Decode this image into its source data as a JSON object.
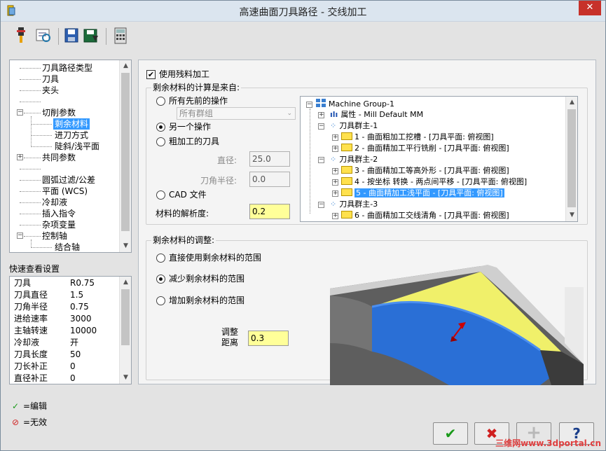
{
  "window": {
    "title": "高速曲面刀具路径 - 交线加工",
    "close_glyph": "✕"
  },
  "toolbar": {
    "icons": [
      "tool-icon",
      "preview-icon",
      "save-icon",
      "load-icon",
      "calculator-icon"
    ]
  },
  "nav_tree": {
    "items": [
      {
        "label": "刀具路径类型"
      },
      {
        "label": "刀具"
      },
      {
        "label": "夹头"
      },
      {
        "label": ""
      },
      {
        "label": "切削参数"
      },
      {
        "label": "剩余材料"
      },
      {
        "label": "进刀方式"
      },
      {
        "label": "陡斜/浅平面"
      },
      {
        "label": "共同参数"
      },
      {
        "label": ""
      },
      {
        "label": "圆弧过滤/公差"
      },
      {
        "label": "平面 (WCS)"
      },
      {
        "label": "冷却液"
      },
      {
        "label": "插入指令"
      },
      {
        "label": "杂项变量"
      },
      {
        "label": "控制轴"
      },
      {
        "label": "结合轴"
      }
    ]
  },
  "quick_view": {
    "title": "快速查看设置",
    "rows": [
      {
        "key": "刀具",
        "value": "R0.75"
      },
      {
        "key": "刀具直径",
        "value": "1.5"
      },
      {
        "key": "刀角半径",
        "value": "0.75"
      },
      {
        "key": "进给速率",
        "value": "3000"
      },
      {
        "key": "主轴转速",
        "value": "10000"
      },
      {
        "key": "冷却液",
        "value": "开"
      },
      {
        "key": "刀具长度",
        "value": "50"
      },
      {
        "key": "刀长补正",
        "value": "0"
      },
      {
        "key": "直径补正",
        "value": "0"
      }
    ]
  },
  "legend": {
    "edit": "=编辑",
    "invalid": "=无效"
  },
  "main": {
    "use_rest_material": {
      "label": "使用残料加工",
      "checked": true
    },
    "source_group": {
      "title": "剩余材料的计算是来自:",
      "option_all_previous": "所有先前的操作",
      "combo_value": "所有群组",
      "option_another_op": "另一个操作",
      "option_roughed_tool": "粗加工的刀具",
      "diameter_label": "直径:",
      "diameter_value": "25.0",
      "corner_label": "刀角半径:",
      "corner_value": "0.0",
      "option_cad": "CAD 文件",
      "resolution_label": "材料的解析度:",
      "resolution_value": "0.2",
      "selected_option": "另一个操作"
    },
    "ops_tree": [
      {
        "label": "Machine Group-1",
        "indent": 0,
        "kind": "machine"
      },
      {
        "label": "属性 - Mill Default MM",
        "indent": 1,
        "kind": "props"
      },
      {
        "label": "刀具群主-1",
        "indent": 1,
        "kind": "group"
      },
      {
        "label": "1 - 曲面粗加工挖槽 - [刀具平面: 俯视图]",
        "indent": 2,
        "kind": "op"
      },
      {
        "label": "2 - 曲面精加工平行铣削 - [刀具平面: 俯视图]",
        "indent": 2,
        "kind": "op"
      },
      {
        "label": "刀具群主-2",
        "indent": 1,
        "kind": "group"
      },
      {
        "label": "3 - 曲面精加工等高外形 - [刀具平面: 俯视图]",
        "indent": 2,
        "kind": "op"
      },
      {
        "label": "4 - 按坐标 转换 - 两点间平移 - [刀具平面: 俯视图]",
        "indent": 2,
        "kind": "op"
      },
      {
        "label": "5 - 曲面精加工浅平面 - [刀具平面: 俯视图]",
        "indent": 2,
        "kind": "op-selected"
      },
      {
        "label": "刀具群主-3",
        "indent": 1,
        "kind": "group"
      },
      {
        "label": "6 - 曲面精加工交线清角 - [刀具平面: 俯视图]",
        "indent": 2,
        "kind": "op"
      }
    ],
    "adjust_group": {
      "title": "剩余材料的调整:",
      "option_direct": "直接使用剩余材料的范围",
      "option_reduce": "减少剩余材料的范围",
      "option_increase": "增加剩余材料的范围",
      "selected_option": "减少剩余材料的范围",
      "adjust_distance_label_1": "调整",
      "adjust_distance_label_2": "距离",
      "adjust_distance_value": "0.3"
    }
  },
  "buttons": {
    "ok_glyph": "✔",
    "cancel_glyph": "✖",
    "add_glyph": "+",
    "help_glyph": "?"
  },
  "watermark": "三维网www.3dportal.cn",
  "colors": {
    "selection": "#3399ff",
    "input_highlight": "#ffff99",
    "ok_green": "#1a9a1a",
    "cancel_red": "#d02020"
  }
}
